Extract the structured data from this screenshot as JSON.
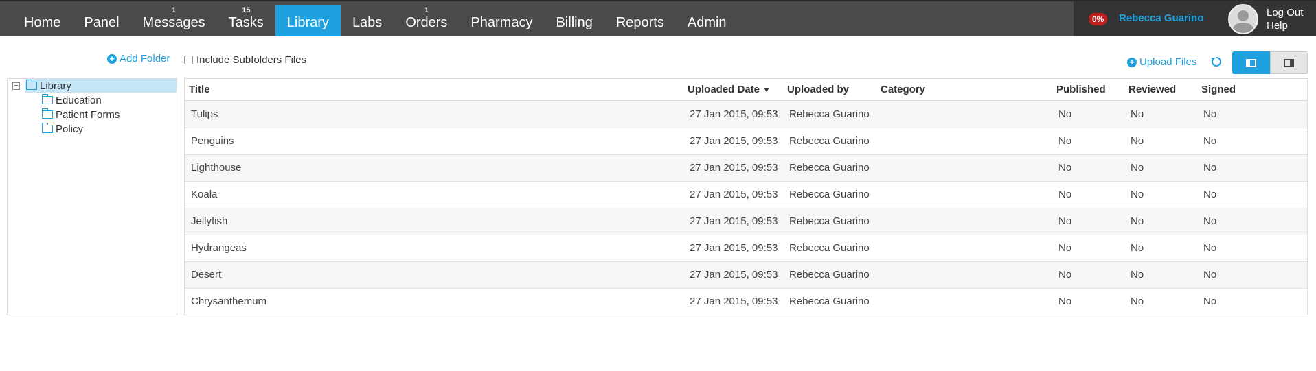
{
  "nav": {
    "items": [
      {
        "label": "Home",
        "badge": ""
      },
      {
        "label": "Panel",
        "badge": ""
      },
      {
        "label": "Messages",
        "badge": "1"
      },
      {
        "label": "Tasks",
        "badge": "15"
      },
      {
        "label": "Library",
        "badge": "",
        "active": true
      },
      {
        "label": "Labs",
        "badge": ""
      },
      {
        "label": "Orders",
        "badge": "1"
      },
      {
        "label": "Pharmacy",
        "badge": ""
      },
      {
        "label": "Billing",
        "badge": ""
      },
      {
        "label": "Reports",
        "badge": ""
      },
      {
        "label": "Admin",
        "badge": ""
      }
    ]
  },
  "user": {
    "progress": "0%",
    "name": "Rebecca Guarino",
    "logout_label": "Log Out",
    "help_label": "Help"
  },
  "toolbar": {
    "add_folder_label": "Add Folder",
    "include_subfolders_label": "Include Subfolders Files",
    "upload_label": "Upload Files"
  },
  "tree": {
    "root": "Library",
    "children": [
      "Education",
      "Patient Forms",
      "Policy"
    ]
  },
  "table": {
    "columns": [
      "Title",
      "Uploaded Date",
      "Uploaded by",
      "Category",
      "Published",
      "Reviewed",
      "Signed"
    ],
    "rows": [
      {
        "title": "Tulips",
        "date": "27 Jan 2015, 09:53",
        "by": "Rebecca Guarino",
        "category": "",
        "published": "No",
        "reviewed": "No",
        "signed": "No"
      },
      {
        "title": "Penguins",
        "date": "27 Jan 2015, 09:53",
        "by": "Rebecca Guarino",
        "category": "",
        "published": "No",
        "reviewed": "No",
        "signed": "No"
      },
      {
        "title": "Lighthouse",
        "date": "27 Jan 2015, 09:53",
        "by": "Rebecca Guarino",
        "category": "",
        "published": "No",
        "reviewed": "No",
        "signed": "No"
      },
      {
        "title": "Koala",
        "date": "27 Jan 2015, 09:53",
        "by": "Rebecca Guarino",
        "category": "",
        "published": "No",
        "reviewed": "No",
        "signed": "No"
      },
      {
        "title": "Jellyfish",
        "date": "27 Jan 2015, 09:53",
        "by": "Rebecca Guarino",
        "category": "",
        "published": "No",
        "reviewed": "No",
        "signed": "No"
      },
      {
        "title": "Hydrangeas",
        "date": "27 Jan 2015, 09:53",
        "by": "Rebecca Guarino",
        "category": "",
        "published": "No",
        "reviewed": "No",
        "signed": "No"
      },
      {
        "title": "Desert",
        "date": "27 Jan 2015, 09:53",
        "by": "Rebecca Guarino",
        "category": "",
        "published": "No",
        "reviewed": "No",
        "signed": "No"
      },
      {
        "title": "Chrysanthemum",
        "date": "27 Jan 2015, 09:53",
        "by": "Rebecca Guarino",
        "category": "",
        "published": "No",
        "reviewed": "No",
        "signed": "No"
      }
    ]
  },
  "colors": {
    "accent": "#1ea1de",
    "nav_bg": "#4a4a4a",
    "user_panel_bg": "#343434",
    "badge_red": "#c0211f",
    "tree_selected": "#c5e6f7"
  }
}
